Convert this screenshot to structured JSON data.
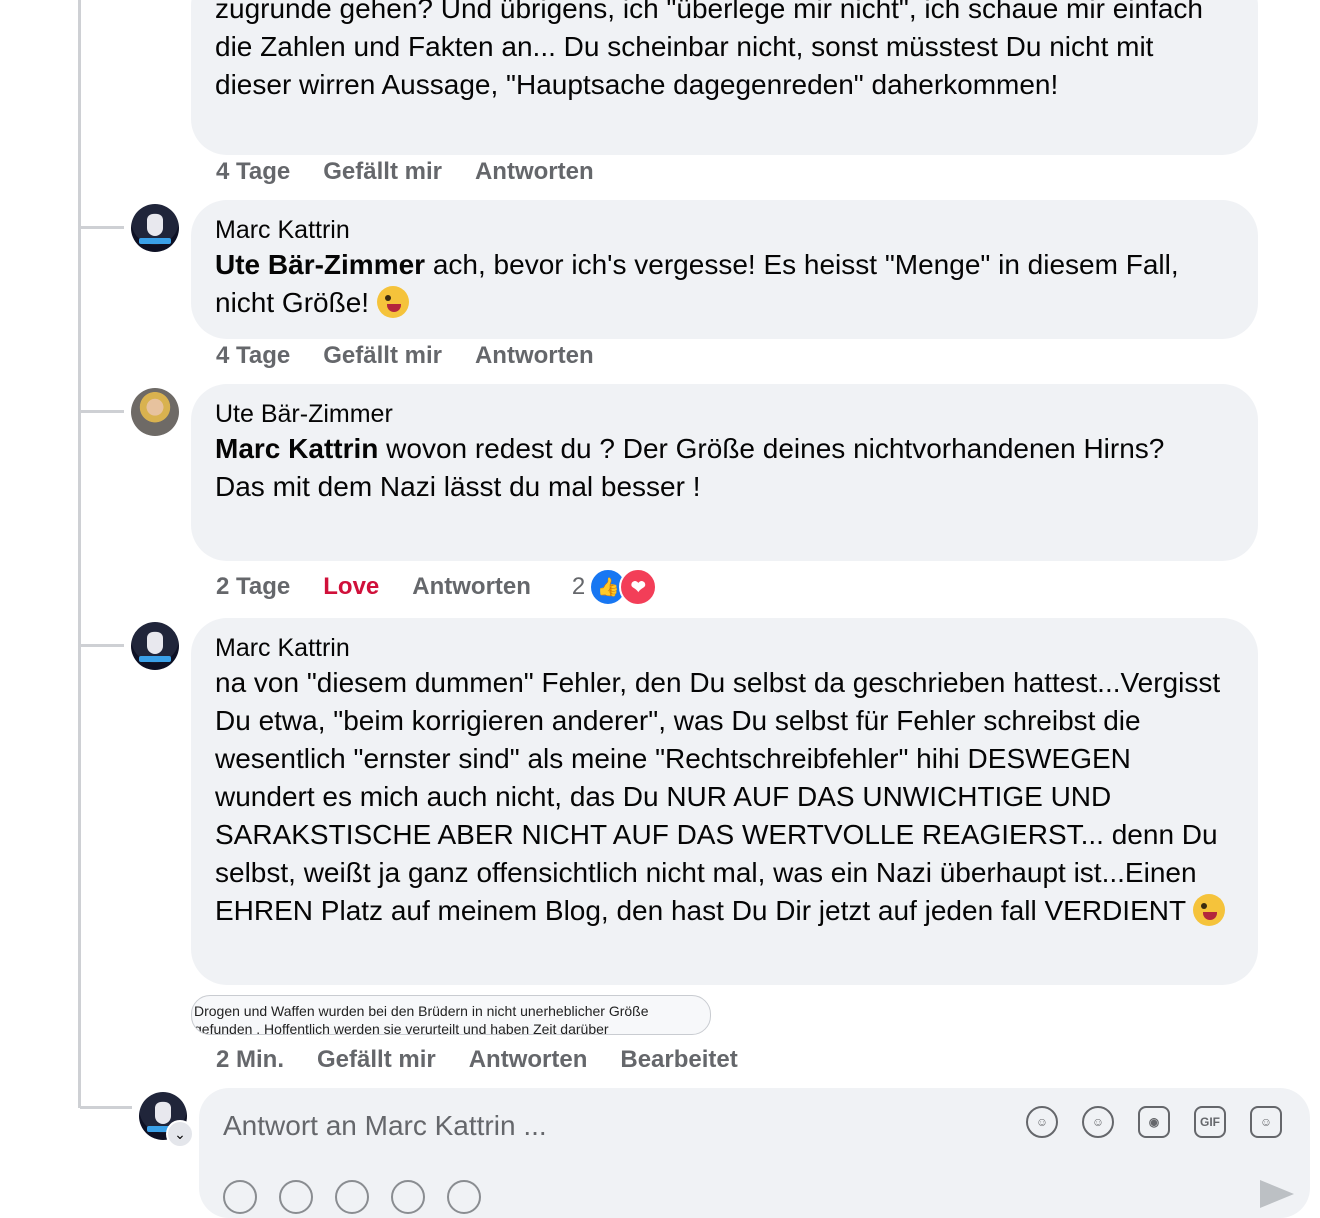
{
  "comments": [
    {
      "text": "zugrunde gehen? Und übrigens, ich \"überlege mir nicht\", ich schaue mir einfach die Zahlen und Fakten an... Du scheinbar nicht, sonst müsstest Du nicht mit dieser wirren Aussage, \"Hauptsache dagegenreden\" daherkommen!",
      "time": "4 Tage",
      "like": "Gefällt mir",
      "reply": "Antworten"
    },
    {
      "author": "Marc Kattrin",
      "mention": "Ute Bär-Zimmer",
      "text": " ach, bevor ich's vergesse! Es heisst \"Menge\" in diesem Fall, nicht Größe! ",
      "time": "4 Tage",
      "like": "Gefällt mir",
      "reply": "Antworten"
    },
    {
      "author": "Ute Bär-Zimmer",
      "mention": "Marc Kattrin",
      "text": " wovon redest du ? Der Größe deines nichtvorhandenen Hirns?",
      "text2": "Das mit dem Nazi lässt du mal besser !",
      "time": "2 Tage",
      "like": "Love",
      "reply": "Antworten",
      "reaction_count": "2"
    },
    {
      "author": "Marc Kattrin",
      "text": "na von \"diesem dummen\" Fehler, den Du selbst da geschrieben hattest...Vergisst Du etwa, \"beim korrigieren anderer\", was Du selbst für Fehler schreibst die wesentlich \"ernster sind\" als meine \"Rechtschreibfehler\" hihi DESWEGEN wundert es mich auch nicht, das Du NUR AUF DAS UNWICHTIGE UND SARAKSTISCHE ABER NICHT AUF DAS WERTVOLLE REAGIERST... denn Du selbst, weißt ja ganz offensichtlich nicht mal, was ein Nazi überhaupt ist...Einen EHREN Platz auf meinem Blog, den hast Du Dir jetzt auf jeden fall VERDIENT ",
      "time": "2 Min.",
      "like": "Gefällt mir",
      "reply": "Antworten",
      "edited": "Bearbeitet"
    }
  ],
  "quoted_preview": {
    "line1": "Drogen und Waffen wurden bei den Brüdern in nicht unerheblicher Größe",
    "line2": "gefunden . Hoffentlich werden sie verurteilt und haben Zeit darüber"
  },
  "composer": {
    "placeholder": "Antwort an Marc Kattrin ...",
    "icons": [
      "avatar-sticker-icon",
      "emoji-icon",
      "camera-icon",
      "gif-icon",
      "sticker-icon"
    ],
    "gif_label": "GIF"
  }
}
